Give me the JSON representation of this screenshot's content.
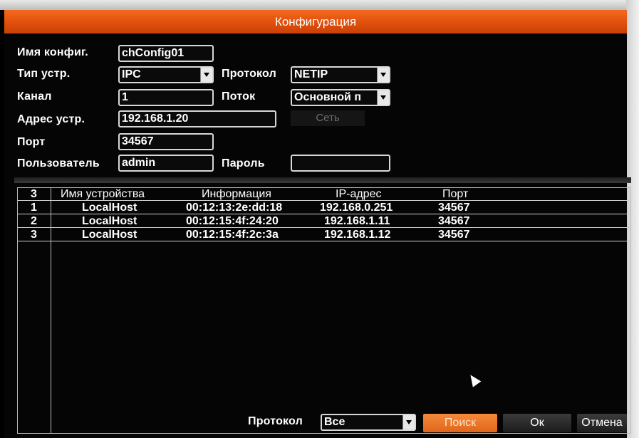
{
  "window": {
    "title": "Конфигурация"
  },
  "form": {
    "config_name_label": "Имя конфиг.",
    "config_name_value": "chConfig01",
    "device_type_label": "Тип устр.",
    "device_type_value": "IPC",
    "protocol_label": "Протокол",
    "protocol_value": "NETIP",
    "channel_label": "Канал",
    "channel_value": "1",
    "stream_label": "Поток",
    "stream_value": "Основной п",
    "device_address_label": "Адрес устр.",
    "device_address_value": "192.168.1.20",
    "network_button_label": "Сеть",
    "port_label": "Порт",
    "port_value": "34567",
    "user_label": "Пользователь",
    "user_value": "admin",
    "password_label": "Пароль",
    "password_value": ""
  },
  "table": {
    "headers": [
      "3",
      "Имя устройства",
      "Информация",
      "IP-адрес",
      "Порт"
    ],
    "rows": [
      [
        "1",
        "LocalHost",
        "00:12:13:2e:dd:18",
        "192.168.0.251",
        "34567"
      ],
      [
        "2",
        "LocalHost",
        "00:12:15:4f:24:20",
        "192.168.1.11",
        "34567"
      ],
      [
        "3",
        "LocalHost",
        "00:12:15:4f:2c:3a",
        "192.168.1.12",
        "34567"
      ]
    ]
  },
  "footer": {
    "protocol_label": "Протокол",
    "protocol_value": "Все",
    "search_button": "Поиск",
    "ok_button": "Ок",
    "cancel_button": "Отмена"
  },
  "colors": {
    "titlebar": "#e85a12",
    "search_button": "#f07a2a"
  }
}
